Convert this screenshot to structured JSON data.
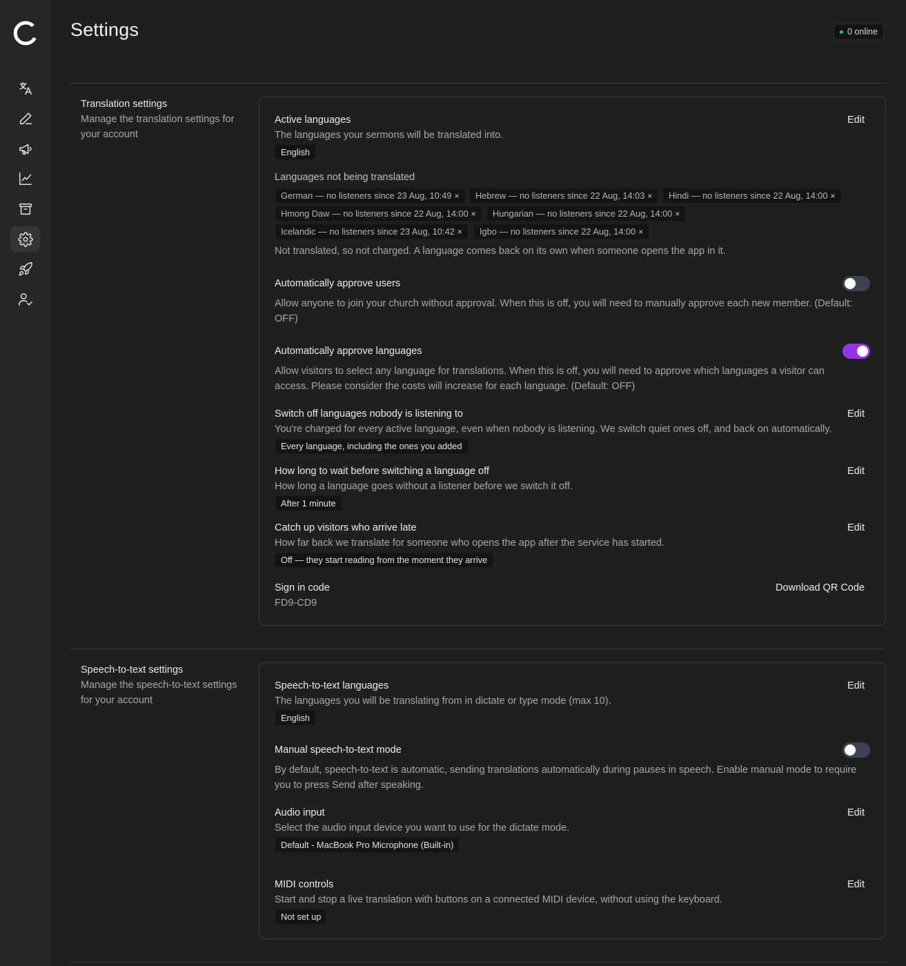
{
  "app": {
    "title": "Settings",
    "online_status": "0 online"
  },
  "sidebar": {
    "items": [
      {
        "name": "translate",
        "icon": "translate-icon"
      },
      {
        "name": "edit",
        "icon": "pen-icon"
      },
      {
        "name": "announcements",
        "icon": "megaphone-icon"
      },
      {
        "name": "analytics",
        "icon": "chart-line-icon"
      },
      {
        "name": "archive",
        "icon": "archive-icon"
      },
      {
        "name": "settings",
        "icon": "gear-icon",
        "active": true
      },
      {
        "name": "launch",
        "icon": "rocket-icon"
      },
      {
        "name": "users",
        "icon": "user-check-icon"
      }
    ]
  },
  "translation": {
    "title": "Translation settings",
    "description": "Manage the translation settings for your account",
    "active_languages": {
      "label": "Active languages",
      "edit": "Edit",
      "description": "The languages your sermons will be translated into.",
      "chips": [
        "English"
      ]
    },
    "not_translated": {
      "label": "Languages not being translated",
      "chips": [
        "German — no listeners since 23 Aug, 10:49",
        "Hebrew — no listeners since 22 Aug, 14:03",
        "Hindi — no listeners since 22 Aug, 14:00",
        "Hmong Daw — no listeners since 22 Aug, 14:00",
        "Hungarian — no listeners since 22 Aug, 14:00",
        "Icelandic — no listeners since 23 Aug, 10:42",
        "Igbo — no listeners since 22 Aug, 14:00"
      ],
      "remove_symbol": "×",
      "note": "Not translated, so not charged. A language comes back on its own when someone opens the app in it."
    },
    "auto_approve_users": {
      "label": "Automatically approve users",
      "description": "Allow anyone to join your church without approval. When this is off, you will need to manually approve each new member. (Default: OFF)",
      "enabled": false
    },
    "auto_approve_languages": {
      "label": "Automatically approve languages",
      "description": "Allow visitors to select any language for translations. When this is off, you will need to approve which languages a visitor can access. Please consider the costs will increase for each language. (Default: OFF)",
      "enabled": true
    },
    "switch_off": {
      "label": "Switch off languages nobody is listening to",
      "edit": "Edit",
      "description": "You're charged for every active language, even when nobody is listening. We switch quiet ones off, and back on automatically.",
      "value": "Every language, including the ones you added"
    },
    "wait_time": {
      "label": "How long to wait before switching a language off",
      "edit": "Edit",
      "description": "How long a language goes without a listener before we switch it off.",
      "value": "After 1 minute"
    },
    "catch_up": {
      "label": "Catch up visitors who arrive late",
      "edit": "Edit",
      "description": "How far back we translate for someone who opens the app after the service has started.",
      "value": "Off — they start reading from the moment they arrive"
    },
    "sign_in": {
      "label": "Sign in code",
      "code": "FD9-CD9",
      "action": "Download QR Code"
    }
  },
  "stt": {
    "title": "Speech-to-text settings",
    "description": "Manage the speech-to-text settings for your account",
    "languages": {
      "label": "Speech-to-text languages",
      "edit": "Edit",
      "description": "The languages you will be translating from in dictate or type mode (max 10).",
      "chips": [
        "English"
      ]
    },
    "manual_mode": {
      "label": "Manual speech-to-text mode",
      "description": "By default, speech-to-text is automatic, sending translations automatically during pauses in speech. Enable manual mode to require you to press Send after speaking.",
      "enabled": false
    },
    "audio_input": {
      "label": "Audio input",
      "edit": "Edit",
      "description": "Select the audio input device you want to use for the dictate mode.",
      "value": "Default - MacBook Pro Microphone (Built-in)"
    },
    "midi": {
      "label": "MIDI controls",
      "edit": "Edit",
      "description": "Start and stop a live translation with buttons on a connected MIDI device, without using the keyboard.",
      "value": "Not set up"
    }
  },
  "colors": {
    "background": "#1f1f1f",
    "sidebar": "#262626",
    "accent": "#9333ea",
    "online": "#22c55e"
  }
}
